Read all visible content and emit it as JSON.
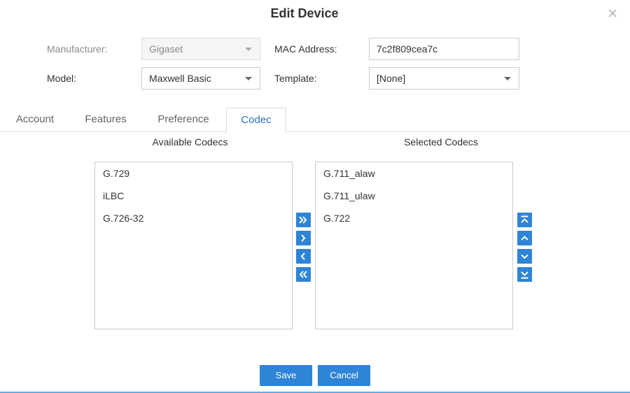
{
  "dialog": {
    "title": "Edit Device"
  },
  "form": {
    "manufacturer_label": "Manufacturer:",
    "manufacturer_value": "Gigaset",
    "mac_label": "MAC Address:",
    "mac_value": "7c2f809cea7c",
    "model_label": "Model:",
    "model_value": "Maxwell Basic",
    "template_label": "Template:",
    "template_value": "[None]"
  },
  "tabs": [
    {
      "label": "Account"
    },
    {
      "label": "Features"
    },
    {
      "label": "Preference"
    },
    {
      "label": "Codec"
    }
  ],
  "codec": {
    "available_header": "Available Codecs",
    "selected_header": "Selected Codecs",
    "available": [
      "G.729",
      "iLBC",
      "G.726-32"
    ],
    "selected": [
      "G.711_alaw",
      "G.711_ulaw",
      "G.722"
    ]
  },
  "icons": {
    "close": "close-icon",
    "move_all_right": "double-chevron-right-icon",
    "move_right": "chevron-right-icon",
    "move_left": "chevron-left-icon",
    "move_all_left": "double-chevron-left-icon",
    "move_top": "move-to-top-icon",
    "move_up": "chevron-up-icon",
    "move_down": "chevron-down-icon",
    "move_bottom": "move-to-bottom-icon"
  },
  "colors": {
    "accent": "#2e84d6",
    "active_tab_text": "#2b74c4"
  },
  "buttons": {
    "save": "Save",
    "cancel": "Cancel"
  }
}
